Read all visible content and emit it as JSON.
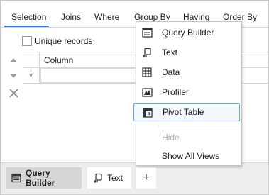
{
  "tabs": [
    {
      "label": "Selection"
    },
    {
      "label": "Joins"
    },
    {
      "label": "Where"
    },
    {
      "label": "Group By"
    },
    {
      "label": "Having"
    },
    {
      "label": "Order By"
    }
  ],
  "options": {
    "unique_records_label": "Unique records",
    "unique_records_checked": false
  },
  "grid": {
    "column_header": "Column",
    "new_row_marker": "*"
  },
  "bottom_tabs": [
    {
      "label": "Query Builder",
      "icon": "query-builder-icon",
      "active": true
    },
    {
      "label": "Text",
      "icon": "text-view-icon",
      "active": false
    }
  ],
  "add_button": {
    "label": "+"
  },
  "menu": {
    "items": [
      {
        "label": "Query Builder",
        "icon": "query-builder-icon"
      },
      {
        "label": "Text",
        "icon": "text-view-icon"
      },
      {
        "label": "Data",
        "icon": "data-grid-icon"
      },
      {
        "label": "Profiler",
        "icon": "profiler-icon"
      },
      {
        "label": "Pivot Table",
        "icon": "pivot-table-icon",
        "highlighted": true
      },
      {
        "label": "Hide",
        "disabled": true
      },
      {
        "label": "Show All Views"
      }
    ]
  },
  "colors": {
    "accent": "#2b79d6",
    "highlight_border": "#6aa3e8",
    "bottom_bar": "#ededed"
  }
}
